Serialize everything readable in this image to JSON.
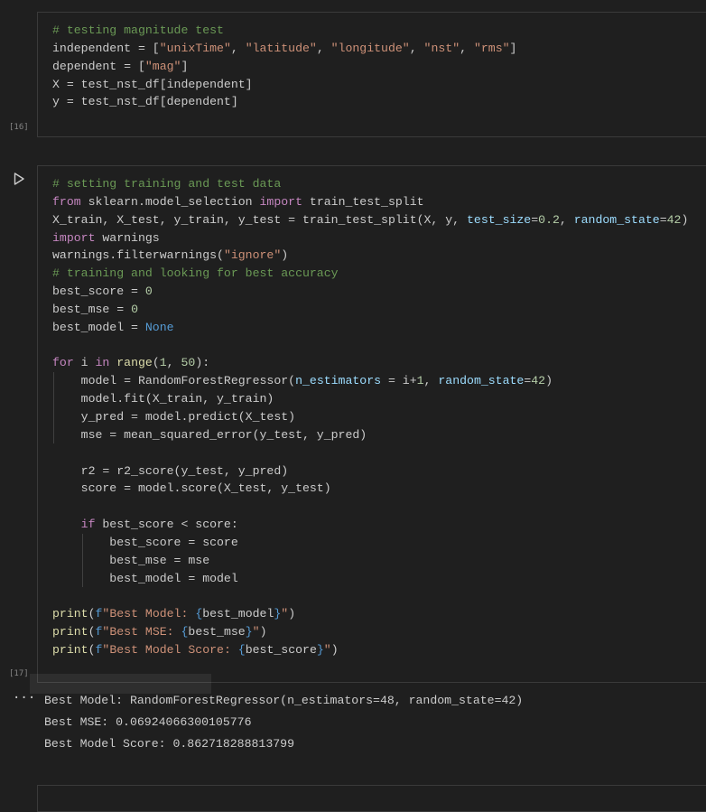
{
  "cells": [
    {
      "exec_count": "[16]",
      "lines": [
        [
          [
            "c",
            "# testing magnitude test"
          ]
        ],
        [
          [
            "",
            "independent = ["
          ],
          [
            "s",
            "\"unixTime\""
          ],
          [
            "",
            ", "
          ],
          [
            "s",
            "\"latitude\""
          ],
          [
            "",
            ", "
          ],
          [
            "s",
            "\"longitude\""
          ],
          [
            "",
            ", "
          ],
          [
            "s",
            "\"nst\""
          ],
          [
            "",
            ", "
          ],
          [
            "s",
            "\"rms\""
          ],
          [
            "",
            "]"
          ]
        ],
        [
          [
            "",
            "dependent = ["
          ],
          [
            "s",
            "\"mag\""
          ],
          [
            "",
            "]"
          ]
        ],
        [
          [
            "",
            "X = test_nst_df[independent]"
          ]
        ],
        [
          [
            "",
            "y = test_nst_df[dependent]"
          ]
        ]
      ]
    },
    {
      "exec_count": "[17]",
      "lines": [
        [
          [
            "c",
            "# setting training and test data"
          ]
        ],
        [
          [
            "k",
            "from"
          ],
          [
            "",
            " sklearn.model_selection "
          ],
          [
            "k",
            "import"
          ],
          [
            "",
            " train_test_split"
          ]
        ],
        [
          [
            "",
            "X_train, X_test, y_train, y_test = train_test_split(X, y, "
          ],
          [
            "p",
            "test_size"
          ],
          [
            "",
            "="
          ],
          [
            "n",
            "0.2"
          ],
          [
            "",
            ", "
          ],
          [
            "p",
            "random_state"
          ],
          [
            "",
            "="
          ],
          [
            "n",
            "42"
          ],
          [
            "",
            ")"
          ]
        ],
        [
          [
            "k",
            "import"
          ],
          [
            "",
            " warnings"
          ]
        ],
        [
          [
            "",
            "warnings.filterwarnings("
          ],
          [
            "s",
            "\"ignore\""
          ],
          [
            "",
            ")"
          ]
        ],
        [
          [
            "c",
            "# training and looking for best accuracy"
          ]
        ],
        [
          [
            "",
            "best_score = "
          ],
          [
            "n",
            "0"
          ]
        ],
        [
          [
            "",
            "best_mse = "
          ],
          [
            "n",
            "0"
          ]
        ],
        [
          [
            "",
            "best_model = "
          ],
          [
            "b",
            "None"
          ]
        ],
        [],
        [
          [
            "k",
            "for"
          ],
          [
            "",
            " i "
          ],
          [
            "k",
            "in"
          ],
          [
            "",
            " "
          ],
          [
            "y",
            "range"
          ],
          [
            "",
            "("
          ],
          [
            "n",
            "1"
          ],
          [
            "",
            ", "
          ],
          [
            "n",
            "50"
          ],
          [
            "",
            "):"
          ]
        ],
        [
          [
            "",
            "    model = RandomForestRegressor("
          ],
          [
            "p",
            "n_estimators"
          ],
          [
            "",
            " = i+"
          ],
          [
            "n",
            "1"
          ],
          [
            "",
            ", "
          ],
          [
            "p",
            "random_state"
          ],
          [
            "",
            "="
          ],
          [
            "n",
            "42"
          ],
          [
            "",
            ")"
          ]
        ],
        [
          [
            "",
            "    model.fit(X_train, y_train)"
          ]
        ],
        [
          [
            "",
            "    y_pred = model.predict(X_test)"
          ]
        ],
        [
          [
            "",
            "    mse = mean_squared_error(y_test, y_pred)"
          ]
        ],
        [],
        [
          [
            "",
            "    r2 = r2_score(y_test, y_pred)"
          ]
        ],
        [
          [
            "",
            "    score = model.score(X_test, y_test)"
          ]
        ],
        [],
        [
          [
            "",
            "    "
          ],
          [
            "k",
            "if"
          ],
          [
            "",
            " best_score < score:"
          ]
        ],
        [
          [
            "",
            "        best_score = score"
          ]
        ],
        [
          [
            "",
            "        best_mse = mse"
          ]
        ],
        [
          [
            "",
            "        best_model = model"
          ]
        ],
        [],
        [
          [
            "y",
            "print"
          ],
          [
            "",
            "("
          ],
          [
            "b",
            "f"
          ],
          [
            "s",
            "\"Best Model: "
          ],
          [
            "b",
            "{"
          ],
          [
            "",
            "best_model"
          ],
          [
            "b",
            "}"
          ],
          [
            "s",
            "\""
          ],
          [
            "",
            ")"
          ]
        ],
        [
          [
            "y",
            "print"
          ],
          [
            "",
            "("
          ],
          [
            "b",
            "f"
          ],
          [
            "s",
            "\"Best MSE: "
          ],
          [
            "b",
            "{"
          ],
          [
            "",
            "best_mse"
          ],
          [
            "b",
            "}"
          ],
          [
            "s",
            "\""
          ],
          [
            "",
            ")"
          ]
        ],
        [
          [
            "y",
            "print"
          ],
          [
            "",
            "("
          ],
          [
            "b",
            "f"
          ],
          [
            "s",
            "\"Best Model Score: "
          ],
          [
            "b",
            "{"
          ],
          [
            "",
            "best_score"
          ],
          [
            "b",
            "}"
          ],
          [
            "s",
            "\""
          ],
          [
            "",
            ")"
          ]
        ]
      ],
      "output": [
        "Best Model: RandomForestRegressor(n_estimators=48, random_state=42)",
        "Best MSE: 0.06924066300105776",
        "Best Model Score: 0.862718288813799"
      ]
    }
  ],
  "icons": {
    "run": "play-icon",
    "more": "more-options-icon"
  },
  "colors": {
    "background": "#1f1f1f",
    "comment": "#6a9955",
    "string": "#ce9178",
    "keyword": "#c586c0",
    "number": "#b5cea8",
    "constant": "#569cd6",
    "parameter": "#9cdcfe",
    "function": "#dcdcaa"
  }
}
